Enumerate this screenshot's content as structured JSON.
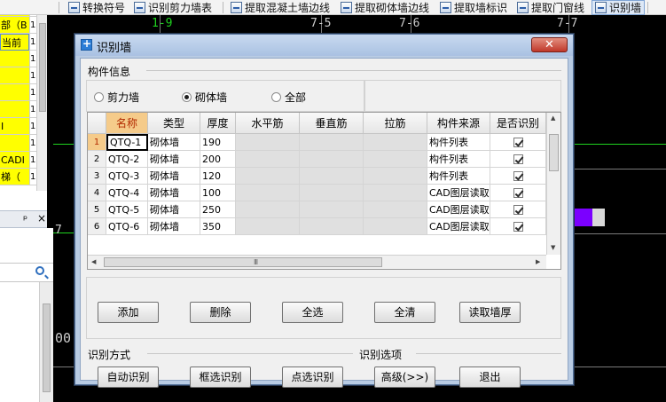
{
  "toolbar": {
    "items": [
      {
        "label": "转换符号"
      },
      {
        "label": "识别剪力墙表"
      },
      {
        "label": "提取混凝土墙边线"
      },
      {
        "label": "提取砌体墙边线"
      },
      {
        "label": "提取墙标识"
      },
      {
        "label": "提取门窗线"
      },
      {
        "label": "识别墙"
      }
    ]
  },
  "left_grid": {
    "rows": [
      {
        "text": "",
        "num": "E"
      },
      {
        "text": "部（B",
        "num": "1"
      },
      {
        "text": "当前",
        "num": "1"
      },
      {
        "text": "",
        "num": "1"
      },
      {
        "text": "",
        "num": "1"
      },
      {
        "text": "",
        "num": "1"
      },
      {
        "text": "",
        "num": "1"
      },
      {
        "text": "I",
        "num": "1"
      },
      {
        "text": "",
        "num": "1"
      },
      {
        "text": "CADI",
        "num": "1"
      },
      {
        "text": "梯（",
        "num": "1"
      }
    ]
  },
  "left_panel": {
    "pin": "ᵖ",
    "close": "×"
  },
  "cad": {
    "labels": [
      "1-9",
      "7-5",
      "7-6",
      "7-7"
    ],
    "misc": [
      "00",
      "7"
    ]
  },
  "dialog": {
    "title": "识别墙",
    "close_symbol": "✕",
    "info_group": "构件信息",
    "radios": [
      {
        "label": "剪力墙",
        "selected": false
      },
      {
        "label": "砌体墙",
        "selected": true
      },
      {
        "label": "全部",
        "selected": false
      }
    ],
    "grid": {
      "columns": [
        "名称",
        "类型",
        "厚度",
        "水平筋",
        "垂直筋",
        "拉筋",
        "构件来源",
        "是否识别"
      ],
      "rows": [
        {
          "num": "1",
          "name": "QTQ-1",
          "type": "砌体墙",
          "thickness": "190",
          "h_bar": "",
          "v_bar": "",
          "tie_bar": "",
          "source": "构件列表",
          "recognize": true
        },
        {
          "num": "2",
          "name": "QTQ-2",
          "type": "砌体墙",
          "thickness": "200",
          "h_bar": "",
          "v_bar": "",
          "tie_bar": "",
          "source": "构件列表",
          "recognize": true
        },
        {
          "num": "3",
          "name": "QTQ-3",
          "type": "砌体墙",
          "thickness": "120",
          "h_bar": "",
          "v_bar": "",
          "tie_bar": "",
          "source": "构件列表",
          "recognize": true
        },
        {
          "num": "4",
          "name": "QTQ-4",
          "type": "砌体墙",
          "thickness": "100",
          "h_bar": "",
          "v_bar": "",
          "tie_bar": "",
          "source": "CAD图层读取",
          "recognize": true
        },
        {
          "num": "5",
          "name": "QTQ-5",
          "type": "砌体墙",
          "thickness": "250",
          "h_bar": "",
          "v_bar": "",
          "tie_bar": "",
          "source": "CAD图层读取",
          "recognize": true
        },
        {
          "num": "6",
          "name": "QTQ-6",
          "type": "砌体墙",
          "thickness": "350",
          "h_bar": "",
          "v_bar": "",
          "tie_bar": "",
          "source": "CAD图层读取",
          "recognize": true
        }
      ]
    },
    "buttons_row1": {
      "add": "添加",
      "delete": "删除",
      "select_all": "全选",
      "clear_all": "全清",
      "read_thickness": "读取墙厚"
    },
    "method_group": "识别方式",
    "options_group": "识别选项",
    "buttons_row2": {
      "auto": "自动识别",
      "box": "框选识别",
      "point": "点选识别",
      "advanced": "高级(>>)",
      "exit": "退出"
    }
  },
  "colors": {
    "highlight": "#ffff00",
    "sel_header": "#f5cb8a",
    "cad_green": "#1fd31f",
    "dialog_frame": "#b8cbe3",
    "close_red": "#c0382a"
  }
}
